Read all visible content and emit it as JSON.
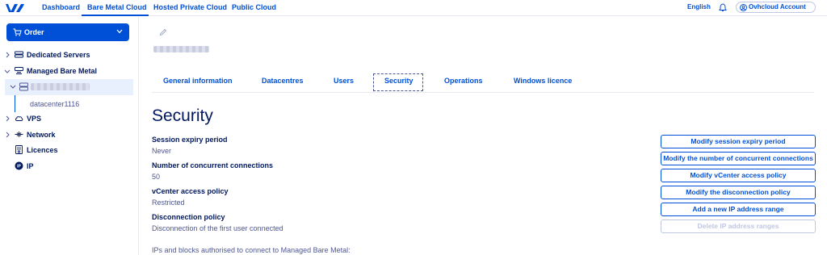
{
  "nav": {
    "links": [
      "Dashboard",
      "Bare Metal Cloud",
      "Hosted Private Cloud",
      "Public Cloud"
    ],
    "language": "English",
    "account": "Ovhcloud Account"
  },
  "sidebar": {
    "order_label": "Order",
    "items": [
      {
        "label": "Dedicated Servers"
      },
      {
        "label": "Managed Bare Metal"
      },
      {
        "label": "VPS"
      },
      {
        "label": "Network"
      },
      {
        "label": "Licences"
      },
      {
        "label": "IP"
      }
    ],
    "datacenter": "datacenter1116"
  },
  "tabs": [
    "General information",
    "Datacentres",
    "Users",
    "Security",
    "Operations",
    "Windows licence"
  ],
  "page": {
    "title": "Security",
    "fields": [
      {
        "label": "Session expiry period",
        "value": "Never"
      },
      {
        "label": "Number of concurrent connections",
        "value": "50"
      },
      {
        "label": "vCenter access policy",
        "value": "Restricted"
      },
      {
        "label": "Disconnection policy",
        "value": "Disconnection of the first user connected"
      }
    ],
    "ip_text": "IPs and blocks authorised to connect to Managed Bare Metal:"
  },
  "actions": [
    "Modify session expiry period",
    "Modify the number of concurrent connections",
    "Modify vCenter access policy",
    "Modify the disconnection policy",
    "Add a new IP address range",
    "Delete IP address ranges"
  ],
  "colors": {
    "brand": "#0050d7",
    "text_dark": "#00185e",
    "text": "#4d5693",
    "disabled": "#bfc7e3",
    "selected_bg": "#e8f0fd"
  }
}
